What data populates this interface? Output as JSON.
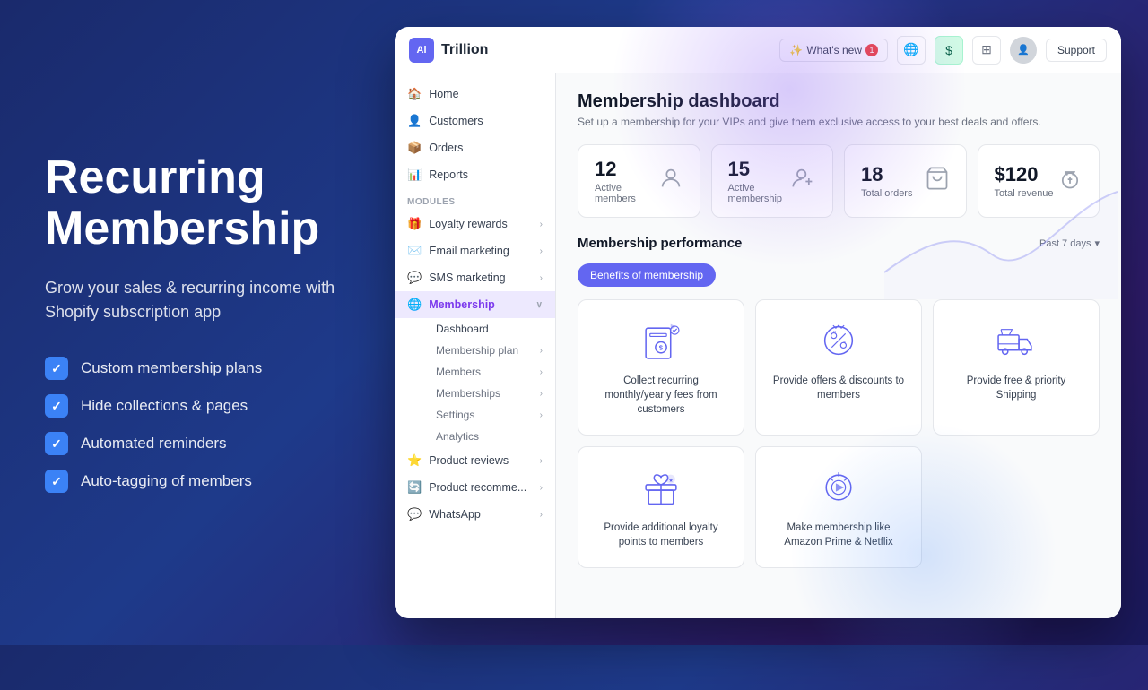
{
  "left": {
    "title_line1": "Recurring",
    "title_line2": "Membership",
    "subtitle": "Grow your sales & recurring income with Shopify subscription app",
    "features": [
      "Custom membership plans",
      "Hide collections & pages",
      "Automated reminders",
      "Auto-tagging of members"
    ]
  },
  "app": {
    "topnav": {
      "logo_text": "Trillion",
      "whats_new": "What's new",
      "support_label": "Support"
    },
    "sidebar": {
      "nav_items": [
        {
          "label": "Home",
          "icon": "🏠"
        },
        {
          "label": "Customers",
          "icon": "👤"
        },
        {
          "label": "Orders",
          "icon": "📦"
        },
        {
          "label": "Reports",
          "icon": "📊"
        }
      ],
      "modules_label": "MODULES",
      "module_items": [
        {
          "label": "Loyalty rewards",
          "icon": "🎁",
          "has_arrow": true
        },
        {
          "label": "Email marketing",
          "icon": "✉️",
          "has_arrow": true
        },
        {
          "label": "SMS marketing",
          "icon": "💬",
          "has_arrow": true
        },
        {
          "label": "Membership",
          "icon": "🌐",
          "active": true,
          "has_arrow": true
        }
      ],
      "membership_sub": [
        {
          "label": "Dashboard",
          "active": true
        },
        {
          "label": "Membership plan",
          "has_arrow": true
        },
        {
          "label": "Members",
          "has_arrow": true
        },
        {
          "label": "Memberships",
          "has_arrow": true
        },
        {
          "label": "Settings",
          "has_arrow": true
        },
        {
          "label": "Analytics"
        }
      ],
      "bottom_items": [
        {
          "label": "Product reviews",
          "icon": "⭐",
          "has_arrow": true
        },
        {
          "label": "Product recomme...",
          "icon": "🔄",
          "has_arrow": true
        },
        {
          "label": "WhatsApp",
          "icon": "💬",
          "has_arrow": true
        }
      ]
    },
    "main": {
      "page_title": "Membership dashboard",
      "page_subtitle": "Set up a membership for your VIPs and give them exclusive access to your best deals and offers.",
      "stats": [
        {
          "value": "12",
          "label": "Active members",
          "icon": "👤"
        },
        {
          "value": "15",
          "label": "Active membership",
          "icon": "👥"
        },
        {
          "value": "18",
          "label": "Total orders",
          "icon": "🛍️"
        },
        {
          "value": "$120",
          "label": "Total revenue",
          "icon": "💰"
        }
      ],
      "performance_title": "Membership performance",
      "period_label": "Past 7 days",
      "tabs": [
        {
          "label": "Benefits of membership",
          "active": true
        }
      ],
      "benefits": [
        {
          "label": "Collect recurring monthly/yearly fees from customers",
          "icon_type": "recurring"
        },
        {
          "label": "Provide offers & discounts to members",
          "icon_type": "discount"
        },
        {
          "label": "Provide free & priority Shipping",
          "icon_type": "shipping"
        },
        {
          "label": "Provide additional loyalty points to members",
          "icon_type": "loyalty"
        },
        {
          "label": "Make membership like Amazon Prime & Netflix",
          "icon_type": "prime"
        }
      ]
    }
  }
}
